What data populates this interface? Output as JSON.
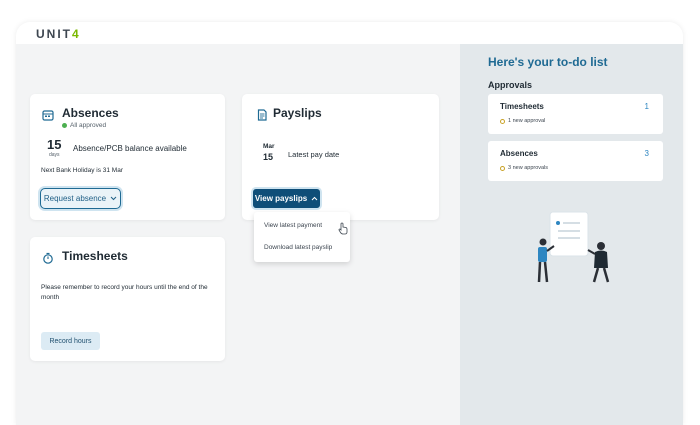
{
  "brand": {
    "logo_main": "UNIT",
    "logo_accent": "4"
  },
  "absences": {
    "title": "Absences",
    "status": "All approved",
    "balance_number": "15",
    "balance_unit": "days",
    "balance_text": "Absence/PCB balance available",
    "holiday_text": "Next Bank Holiday is 31 Mar",
    "request_button": "Request absence"
  },
  "payslips": {
    "title": "Payslips",
    "date_month": "Mar",
    "date_day": "15",
    "date_label": "Latest pay date",
    "view_button": "View payslips",
    "menu": [
      "View latest payment",
      "Download latest payslip"
    ]
  },
  "timesheets": {
    "title": "Timesheets",
    "message": "Please remember to record your hours until the end of the month",
    "record_button": "Record hours"
  },
  "todo": {
    "title": "Here's your to-do list",
    "section": "Approvals",
    "items": [
      {
        "name": "Timesheets",
        "count": "1",
        "sub": "1 new approval"
      },
      {
        "name": "Absences",
        "count": "3",
        "sub": "3 new approvals"
      }
    ]
  },
  "colors": {
    "accent": "#1f6a93",
    "brand_green": "#7ab800",
    "status_green": "#4caf50"
  }
}
